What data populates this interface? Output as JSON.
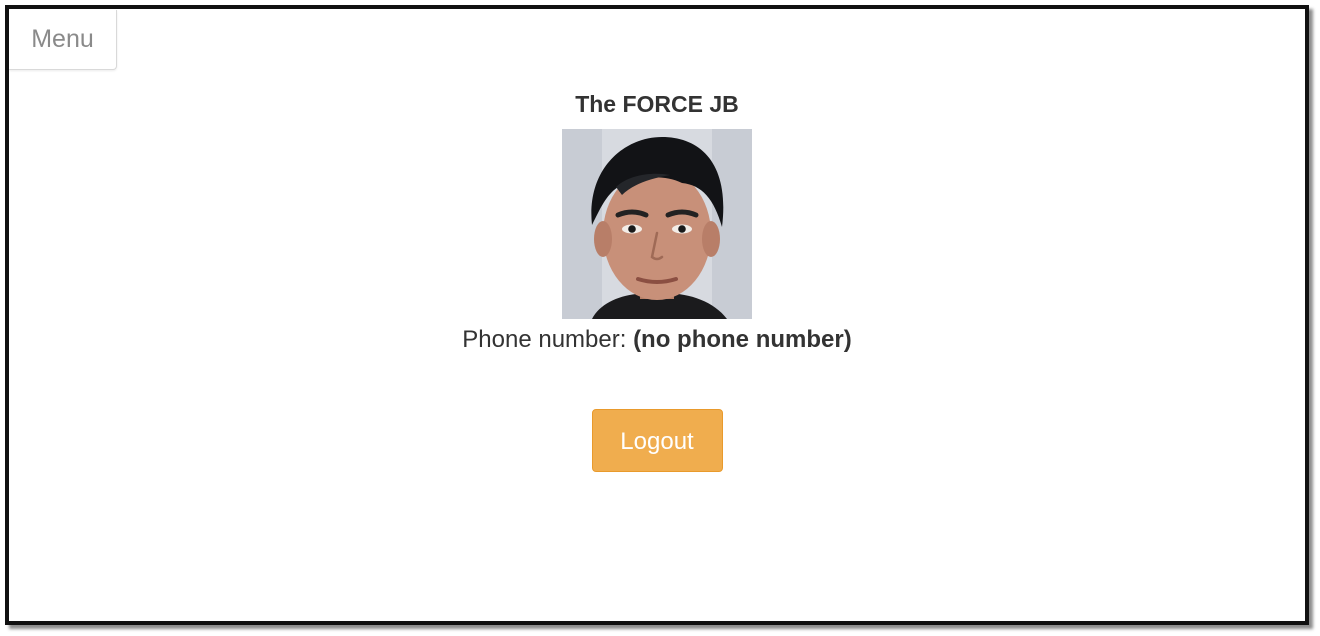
{
  "menu": {
    "label": "Menu"
  },
  "profile": {
    "name": "The FORCE JB",
    "phone_label": "Phone number:",
    "phone_value": "(no phone number)"
  },
  "actions": {
    "logout_label": "Logout",
    "logout_color": "#f0ad4e"
  }
}
